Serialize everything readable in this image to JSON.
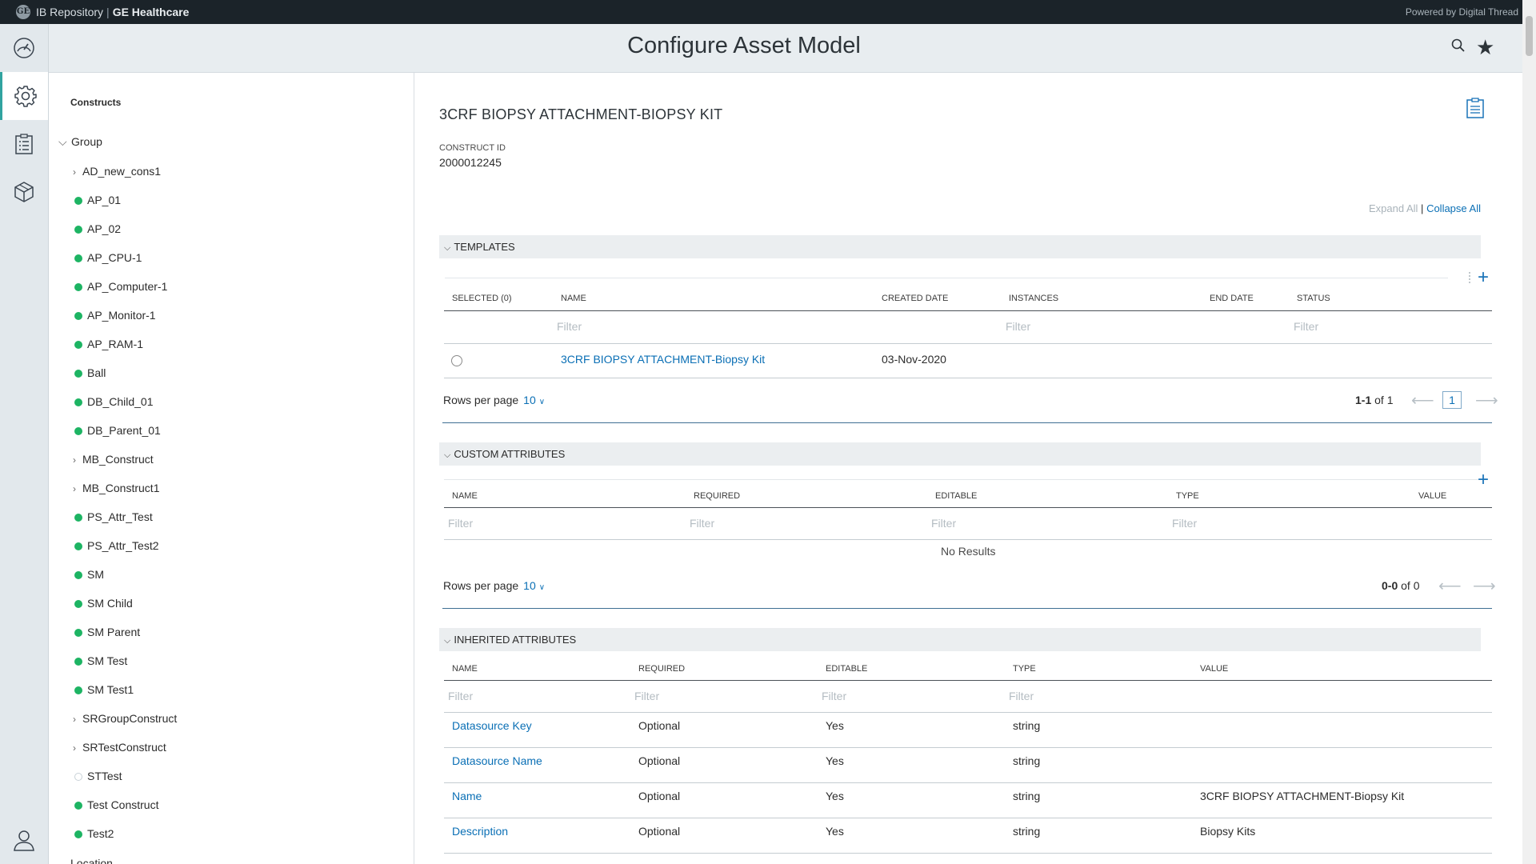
{
  "topbar": {
    "app_name": "IB Repository",
    "separator": "|",
    "brand": "GE Healthcare",
    "powered_by": "Powered by Digital Thread"
  },
  "header": {
    "title": "Configure Asset Model"
  },
  "nav": {
    "items": [
      {
        "icon": "dashboard-gauge-icon"
      },
      {
        "icon": "gear-icon",
        "active": true
      },
      {
        "icon": "clipboard-list-icon"
      },
      {
        "icon": "cube-icon"
      },
      {
        "icon": "user-icon"
      }
    ]
  },
  "constructs": {
    "heading": "Constructs",
    "group_label": "Group",
    "items": [
      {
        "label": "AD_new_cons1",
        "type": "expandable"
      },
      {
        "label": "AP_01",
        "type": "leaf"
      },
      {
        "label": "AP_02",
        "type": "leaf"
      },
      {
        "label": "AP_CPU-1",
        "type": "leaf"
      },
      {
        "label": "AP_Computer-1",
        "type": "leaf"
      },
      {
        "label": "AP_Monitor-1",
        "type": "leaf"
      },
      {
        "label": "AP_RAM-1",
        "type": "leaf"
      },
      {
        "label": "Ball",
        "type": "leaf"
      },
      {
        "label": "DB_Child_01",
        "type": "leaf"
      },
      {
        "label": "DB_Parent_01",
        "type": "leaf"
      },
      {
        "label": "MB_Construct",
        "type": "expandable"
      },
      {
        "label": "MB_Construct1",
        "type": "expandable"
      },
      {
        "label": "PS_Attr_Test",
        "type": "leaf"
      },
      {
        "label": "PS_Attr_Test2",
        "type": "leaf"
      },
      {
        "label": "SM",
        "type": "leaf"
      },
      {
        "label": "SM Child",
        "type": "leaf"
      },
      {
        "label": "SM Parent",
        "type": "leaf"
      },
      {
        "label": "SM Test",
        "type": "leaf"
      },
      {
        "label": "SM Test1",
        "type": "leaf"
      },
      {
        "label": "SRGroupConstruct",
        "type": "expandable"
      },
      {
        "label": "SRTestConstruct",
        "type": "expandable"
      },
      {
        "label": "STTest",
        "type": "hollow"
      },
      {
        "label": "Test Construct",
        "type": "leaf"
      },
      {
        "label": "Test2",
        "type": "leaf"
      }
    ],
    "next_group": "Location"
  },
  "asset": {
    "title": "3CRF BIOPSY ATTACHMENT-BIOPSY KIT",
    "construct_id_label": "CONSTRUCT ID",
    "construct_id": "2000012245",
    "expand_all": "Expand All",
    "divider": "|",
    "collapse_all": "Collapse All"
  },
  "templates": {
    "section_title": "TEMPLATES",
    "columns": [
      "SELECTED (0)",
      "NAME",
      "CREATED DATE",
      "INSTANCES",
      "END DATE",
      "STATUS"
    ],
    "filter_placeholder": "Filter",
    "rows": [
      {
        "name": "3CRF BIOPSY ATTACHMENT-Biopsy Kit",
        "created_date": "03-Nov-2020"
      }
    ],
    "rows_per_page_label": "Rows per page",
    "rows_per_page": "10",
    "range": "1-1",
    "of_total": "of 1",
    "page": "1"
  },
  "custom_attributes": {
    "section_title": "CUSTOM ATTRIBUTES",
    "columns": [
      "NAME",
      "REQUIRED",
      "EDITABLE",
      "TYPE",
      "VALUE"
    ],
    "filter_placeholder": "Filter",
    "no_results": "No Results",
    "rows_per_page_label": "Rows per page",
    "rows_per_page": "10",
    "range": "0-0",
    "of_total": "of 0"
  },
  "inherited_attributes": {
    "section_title": "INHERITED ATTRIBUTES",
    "columns": [
      "NAME",
      "REQUIRED",
      "EDITABLE",
      "TYPE",
      "VALUE"
    ],
    "filter_placeholder": "Filter",
    "rows": [
      {
        "name": "Datasource Key",
        "required": "Optional",
        "editable": "Yes",
        "type": "string",
        "value": ""
      },
      {
        "name": "Datasource Name",
        "required": "Optional",
        "editable": "Yes",
        "type": "string",
        "value": ""
      },
      {
        "name": "Name",
        "required": "Optional",
        "editable": "Yes",
        "type": "string",
        "value": "3CRF BIOPSY ATTACHMENT-Biopsy Kit"
      },
      {
        "name": "Description",
        "required": "Optional",
        "editable": "Yes",
        "type": "string",
        "value": "Biopsy Kits"
      }
    ]
  }
}
